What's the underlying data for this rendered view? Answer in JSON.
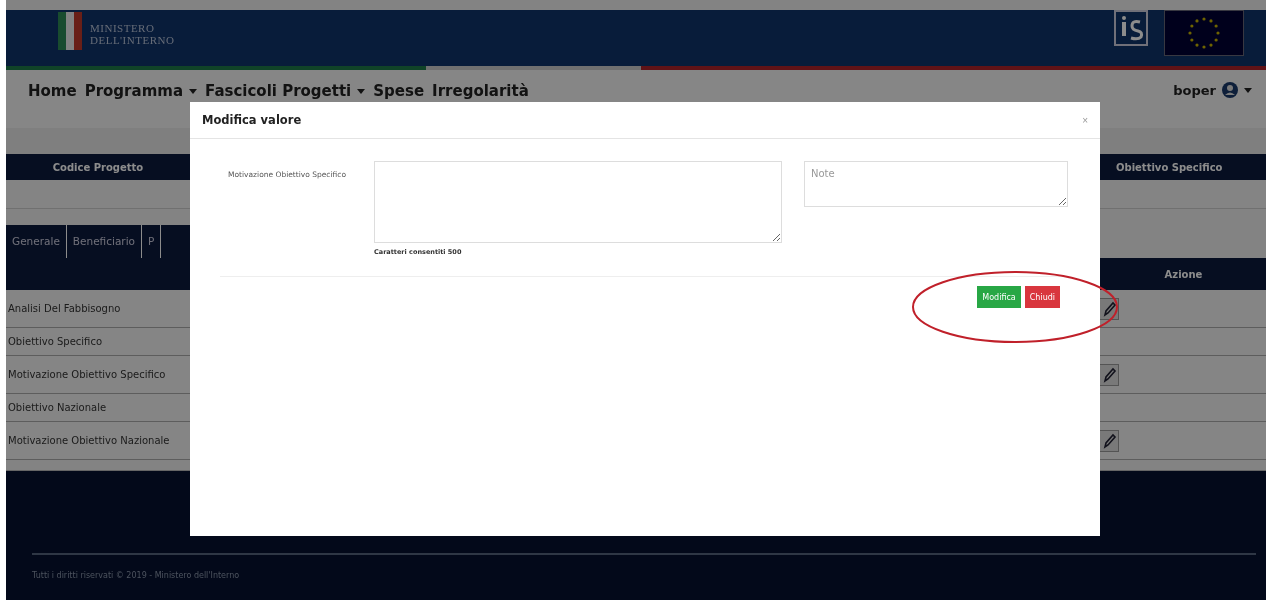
{
  "header": {
    "logo_line1": "MINISTERO",
    "logo_line2": "DELL'INTERNO"
  },
  "nav": {
    "items": [
      {
        "label": "Home",
        "dropdown": false
      },
      {
        "label": "Programma",
        "dropdown": true
      },
      {
        "label": "Fascicoli Progetti",
        "dropdown": true
      },
      {
        "label": "Spese",
        "dropdown": false
      },
      {
        "label": "Irregolarità",
        "dropdown": false
      }
    ],
    "user": "boper"
  },
  "summary_table": {
    "columns": [
      "Codice Progetto",
      "Obiettivo Specifico"
    ]
  },
  "tabs": [
    {
      "label": "Generale",
      "selected": false
    },
    {
      "label": "Beneficiario",
      "selected": false
    },
    {
      "label": "P",
      "selected": false
    }
  ],
  "table": {
    "columns": [
      "Azione"
    ],
    "rows": [
      {
        "label": "Analisi Del Fabbisogno",
        "editable": true
      },
      {
        "label": "Obiettivo Specifico",
        "editable": false
      },
      {
        "label": "Motivazione Obiettivo Specifico",
        "editable": true
      },
      {
        "label": "Obiettivo Nazionale",
        "editable": false
      },
      {
        "label": "Motivazione Obiettivo Nazionale",
        "editable": true
      }
    ]
  },
  "footer": {
    "text": "Tutti i diritti riservati © 2019 - Ministero dell'Interno"
  },
  "modal": {
    "title": "Modifica valore",
    "close": "×",
    "field_label": "Motivazione Obiettivo Specifico",
    "char_limit": "Caratteri consentiti 500",
    "note_placeholder": "Note",
    "buttons": [
      {
        "label": "Modifica",
        "kind": "primary"
      },
      {
        "label": "Chiudi",
        "kind": "danger"
      }
    ],
    "highlight": true
  }
}
